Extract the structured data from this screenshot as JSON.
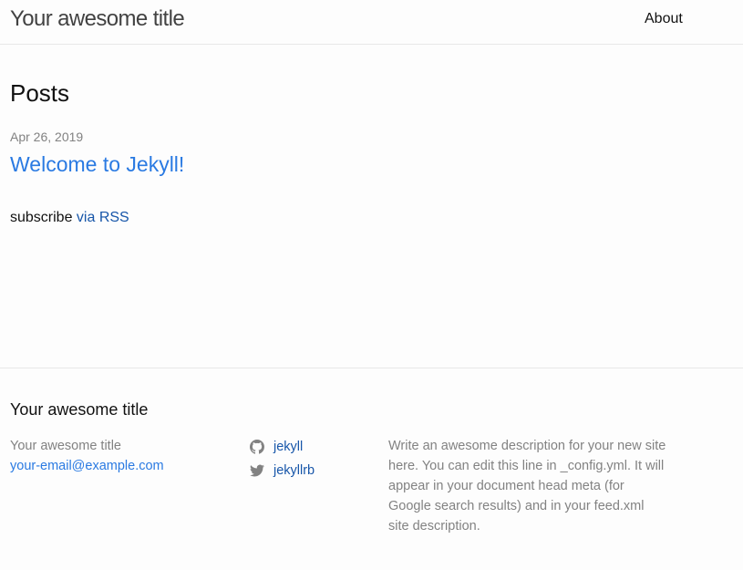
{
  "header": {
    "site_title": "Your awesome title",
    "nav": [
      {
        "label": "About"
      }
    ]
  },
  "main": {
    "heading": "Posts",
    "posts": [
      {
        "date": "Apr 26, 2019",
        "title": "Welcome to Jekyll!"
      }
    ],
    "rss": {
      "prefix": "subscribe ",
      "link_label": "via RSS"
    }
  },
  "footer": {
    "heading": "Your awesome title",
    "contact": {
      "name": "Your awesome title",
      "email": "your-email@example.com"
    },
    "social": [
      {
        "icon": "github-icon",
        "label": "jekyll"
      },
      {
        "icon": "twitter-icon",
        "label": "jekyllrb"
      }
    ],
    "description_lines": [
      "Write an awesome description for your new site",
      "here. You can edit this line in _config.yml. It will",
      "appear in your document head meta (for",
      "Google search results) and in your feed.xml",
      "site description."
    ]
  },
  "colors": {
    "background": "#fdfdfd",
    "text": "#111111",
    "muted": "#828282",
    "link": "#2a7ae2",
    "link_visited": "#1756a9",
    "border": "#e8e8e8"
  }
}
